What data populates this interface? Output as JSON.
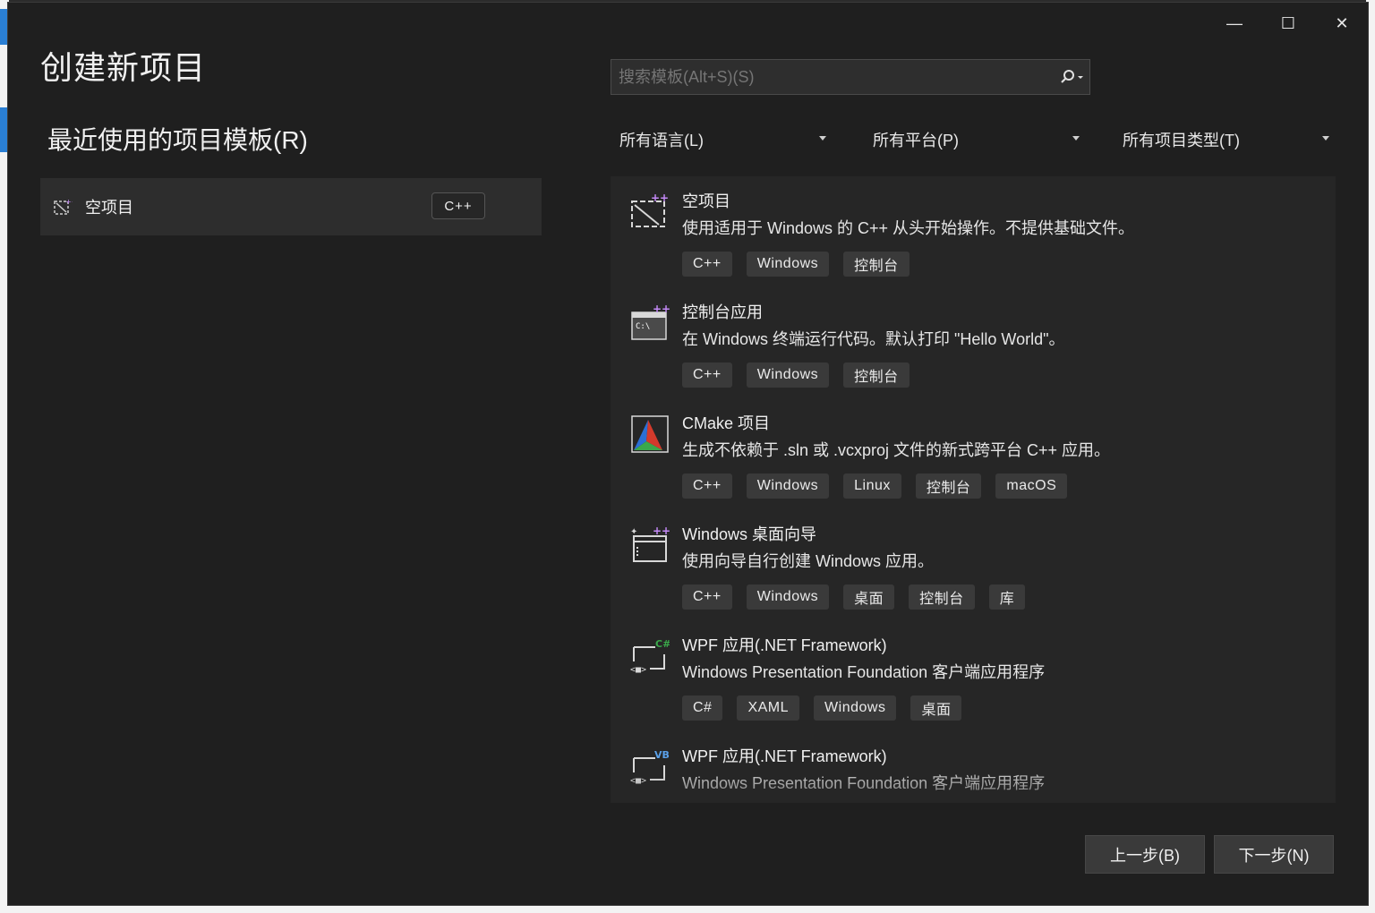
{
  "window": {
    "title": "创建新项目",
    "controls": {
      "minimize": "—",
      "maximize": "☐",
      "close": "✕"
    }
  },
  "recent": {
    "heading": "最近使用的项目模板(R)",
    "items": [
      {
        "name": "空项目",
        "language": "C++",
        "icon": "empty-project-icon"
      }
    ]
  },
  "search": {
    "placeholder": "搜索模板(Alt+S)(S)",
    "value": ""
  },
  "filters": {
    "language": "所有语言(L)",
    "platform": "所有平台(P)",
    "project_type": "所有项目类型(T)"
  },
  "templates": [
    {
      "name": "空项目",
      "description": "使用适用于 Windows 的 C++ 从头开始操作。不提供基础文件。",
      "tags": [
        "C++",
        "Windows",
        "控制台"
      ],
      "icon": "empty-project-icon"
    },
    {
      "name": "控制台应用",
      "description": "在 Windows 终端运行代码。默认打印 \"Hello World\"。",
      "tags": [
        "C++",
        "Windows",
        "控制台"
      ],
      "icon": "console-app-icon"
    },
    {
      "name": "CMake 项目",
      "description": "生成不依赖于 .sln 或 .vcxproj 文件的新式跨平台 C++ 应用。",
      "tags": [
        "C++",
        "Windows",
        "Linux",
        "控制台",
        "macOS"
      ],
      "icon": "cmake-icon"
    },
    {
      "name": "Windows 桌面向导",
      "description": "使用向导自行创建 Windows 应用。",
      "tags": [
        "C++",
        "Windows",
        "桌面",
        "控制台",
        "库"
      ],
      "icon": "desktop-wizard-icon"
    },
    {
      "name": "WPF 应用(.NET Framework)",
      "description": "Windows Presentation Foundation 客户端应用程序",
      "tags": [
        "C#",
        "XAML",
        "Windows",
        "桌面"
      ],
      "icon": "wpf-csharp-icon"
    },
    {
      "name": "WPF 应用(.NET Framework)",
      "description": "Windows Presentation Foundation 客户端应用程序",
      "tags": [],
      "icon": "wpf-vb-icon"
    }
  ],
  "buttons": {
    "back": "上一步(B)",
    "next": "下一步(N)"
  },
  "colors": {
    "background": "#1f1f1f",
    "panel": "#262626",
    "tag": "#3a3a3a",
    "accent_purple": "#c58af9"
  }
}
